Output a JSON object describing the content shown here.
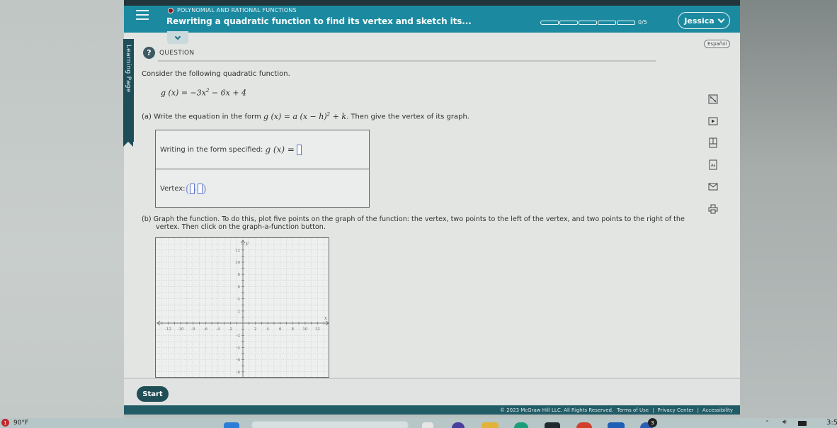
{
  "header": {
    "breadcrumb": "POLYNOMIAL AND RATIONAL FUNCTIONS",
    "title": "Rewriting a quadratic function to find its vertex and sketch its...",
    "progress": {
      "completed": 0,
      "total": 5,
      "label": "0/5"
    },
    "user_name": "Jessica"
  },
  "side_tab": {
    "label": "Learning Page"
  },
  "language_button": "Español",
  "question": {
    "section_label": "QUESTION",
    "intro": "Consider the following quadratic function.",
    "function_lhs": "g (x) = ",
    "function_rhs": "−3x",
    "function_rest": " − 6x + 4",
    "part_a_prefix": "(a) Write the equation in the form ",
    "part_a_form": "g (x) = a (x − h)",
    "part_a_form_tail": " + k",
    "part_a_suffix": ". Then give the vertex of its graph.",
    "form_label": "Writing in the form specified: ",
    "form_math": "g (x) = ",
    "vertex_label": "Vertex: ",
    "part_b_line1": "(b) Graph the function. To do this, plot five points on the graph of the function: the vertex, two points to the left of the vertex, and two points to the right of the",
    "part_b_line2": "vertex. Then click on the graph-a-function button."
  },
  "graph": {
    "x_axis_label": "x",
    "y_axis_label": "y",
    "x_range": [
      -14,
      14
    ],
    "y_range": [
      -10,
      14
    ],
    "x_ticks": [
      -12,
      -10,
      -8,
      -6,
      -4,
      -2,
      2,
      4,
      6,
      8,
      10,
      12
    ],
    "y_ticks": [
      12,
      10,
      8,
      6,
      4,
      2,
      -2,
      -4,
      -6,
      -8
    ]
  },
  "tools": [
    {
      "name": "calculator-icon"
    },
    {
      "name": "video-icon"
    },
    {
      "name": "textbook-icon"
    },
    {
      "name": "dictionary-icon"
    },
    {
      "name": "message-icon"
    },
    {
      "name": "print-icon"
    }
  ],
  "start_button": "Start",
  "footer": {
    "copyright": "© 2023 McGraw Hill LLC. All Rights Reserved.",
    "links": [
      "Terms of Use",
      "Privacy Center",
      "Accessibility"
    ]
  },
  "taskbar": {
    "weather_badge": "1",
    "temperature": "90°F",
    "notification_count": "3",
    "clock": "3:5"
  },
  "colors": {
    "header": "#1b8aa0",
    "footer": "#225c66",
    "start_button": "#204e56",
    "side_tab": "#1d4d58"
  }
}
